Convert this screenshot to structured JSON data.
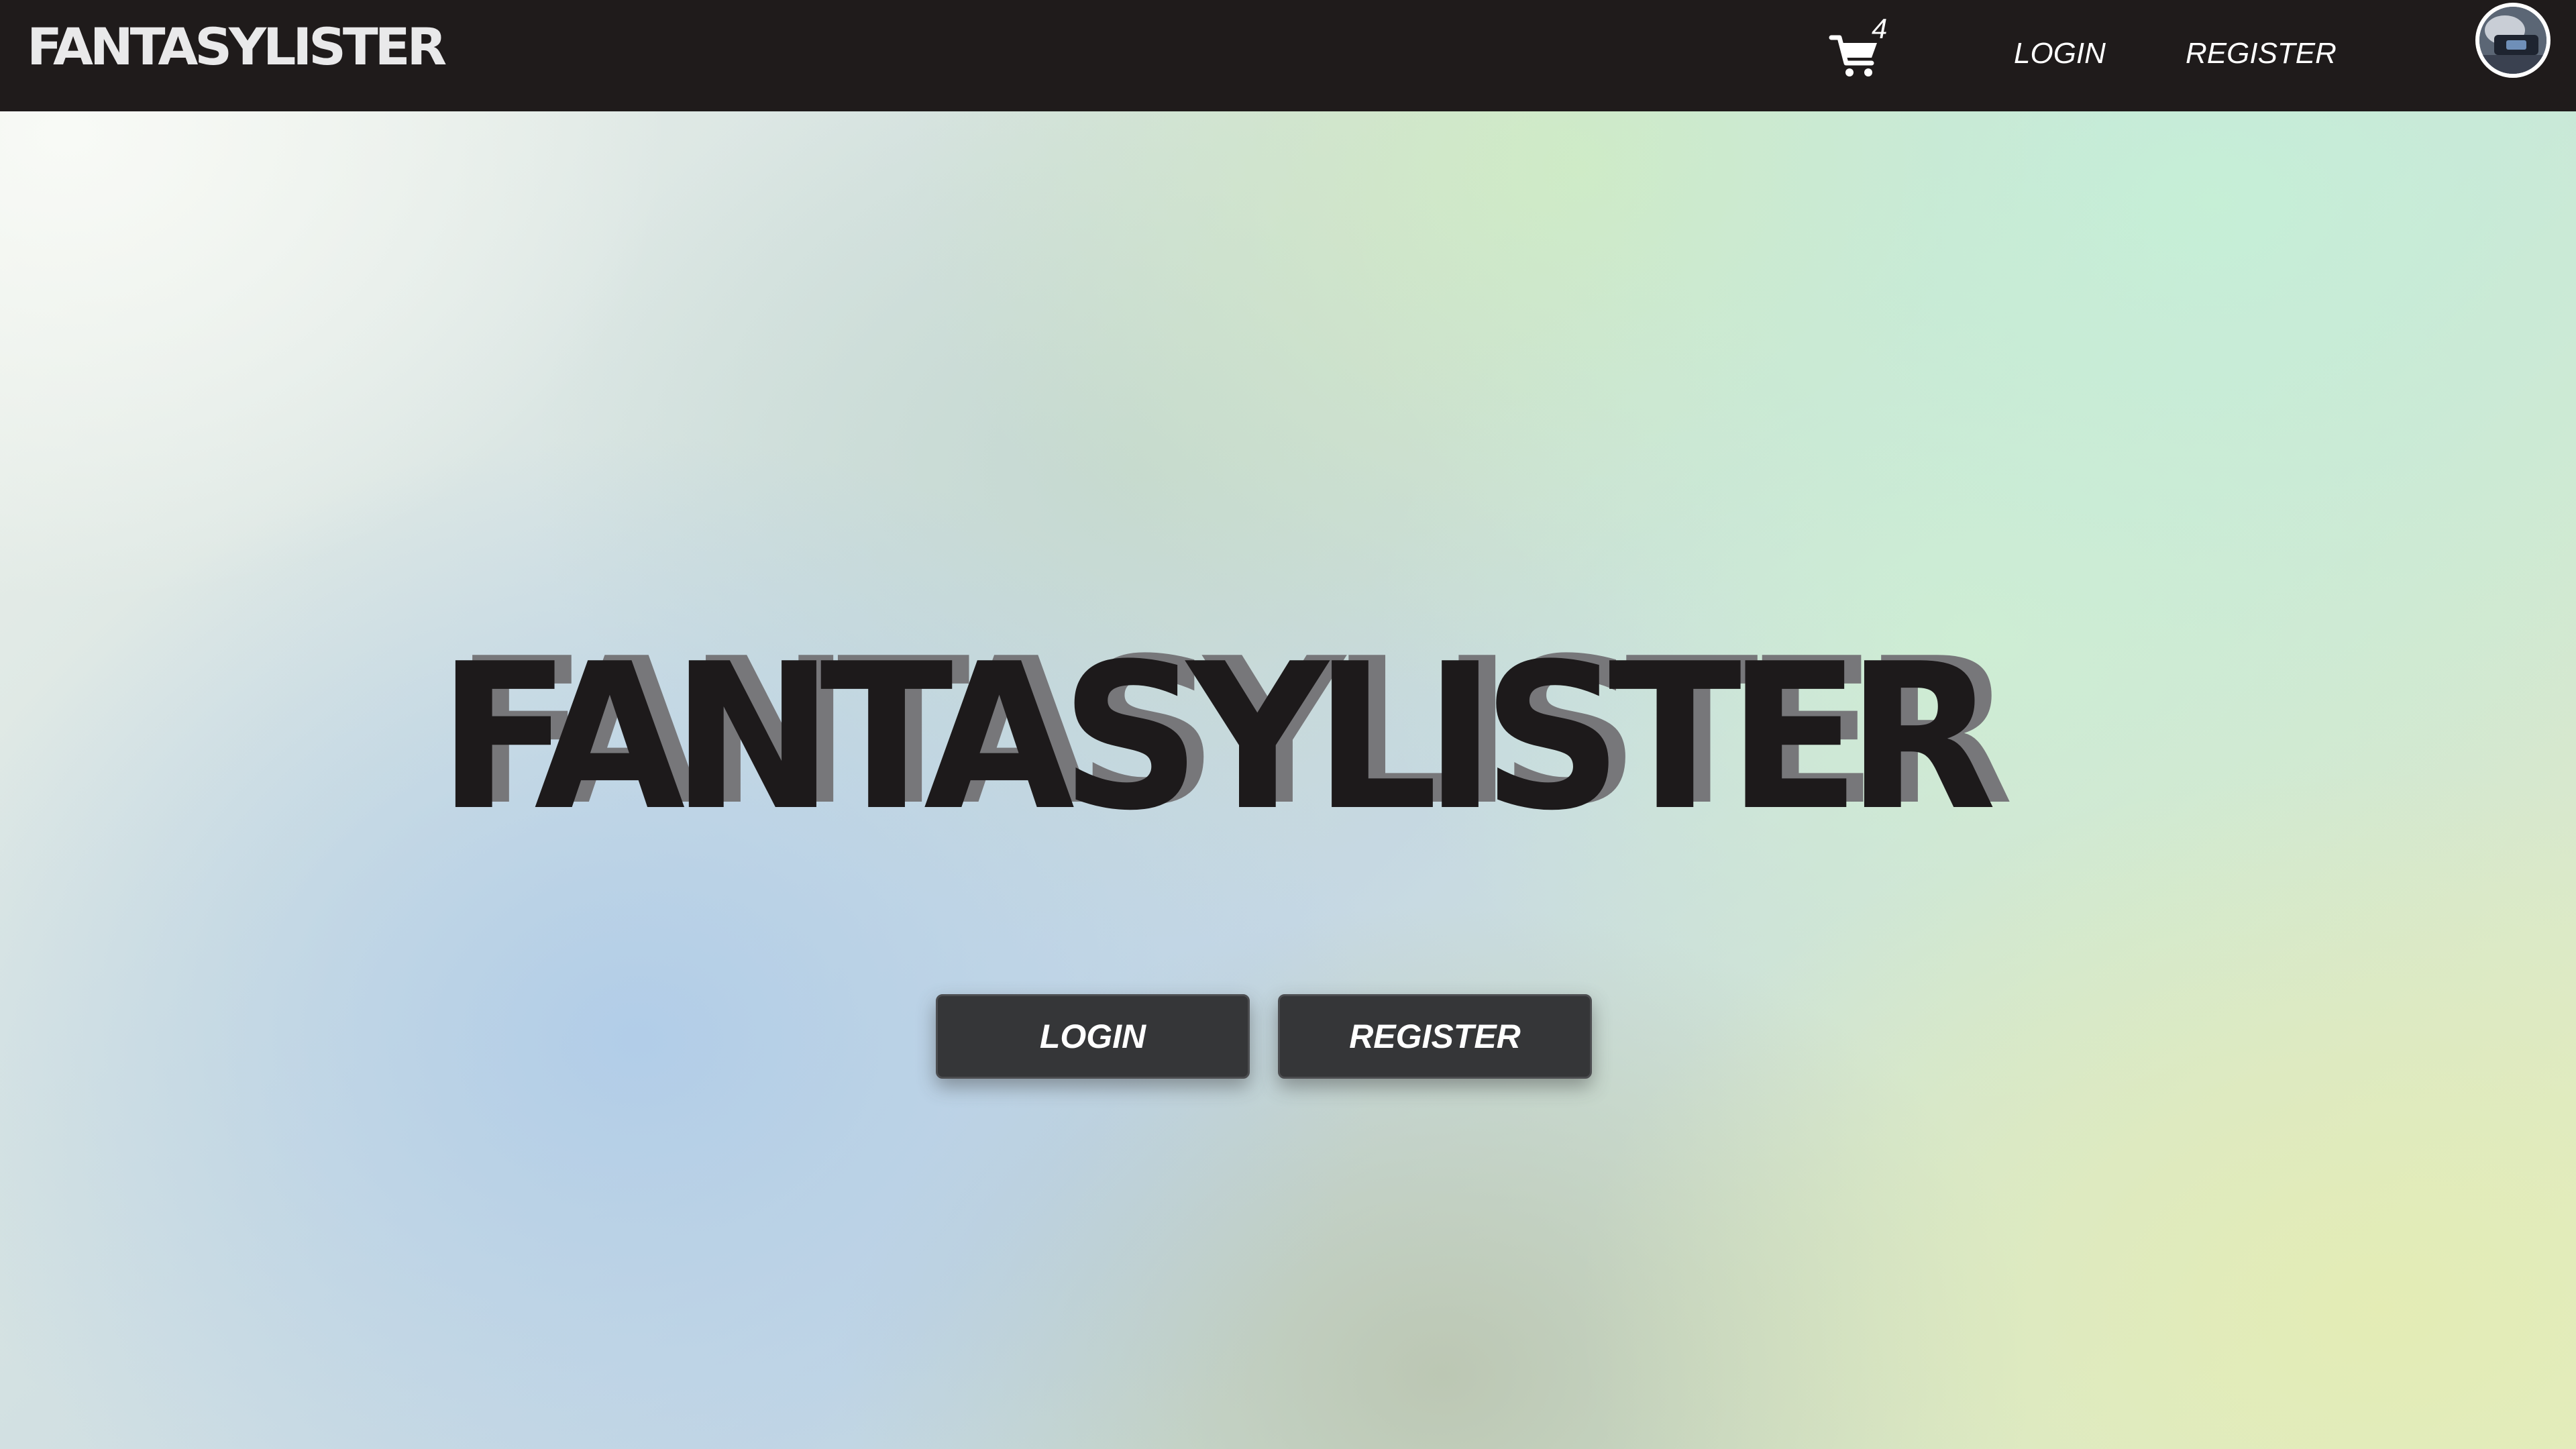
{
  "navbar": {
    "logo_text": "FANTASYLISTER",
    "cart": {
      "icon": "shopping-cart-icon",
      "count": "4"
    },
    "login_label": "LOGIN",
    "register_label": "REGISTER",
    "avatar_icon": "user-avatar"
  },
  "hero": {
    "title": "FANTASYLISTER",
    "login_button": "LOGIN",
    "register_button": "REGISTER"
  },
  "colors": {
    "navbar_bg": "#1f1b1b",
    "button_bg": "#353638",
    "title_color": "#1d1a1b",
    "title_shadow": "#77777a"
  }
}
